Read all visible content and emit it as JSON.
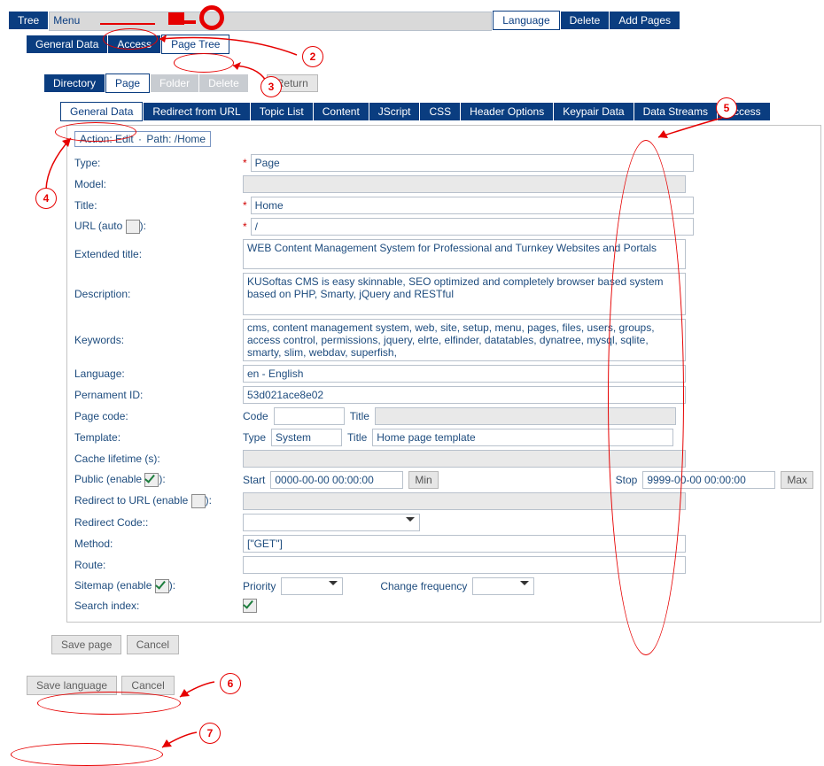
{
  "annotations": {
    "n2": "2",
    "n3": "3",
    "n4": "4",
    "n5": "5",
    "n6": "6",
    "n7": "7"
  },
  "menu1": {
    "tree": "Tree",
    "menu": "Menu",
    "language": "Language",
    "delete": "Delete",
    "addpages": "Add Pages"
  },
  "menu2": {
    "generaldata": "General Data",
    "access": "Access",
    "pagetree": "Page Tree"
  },
  "menu3": {
    "directory": "Directory",
    "page": "Page",
    "folder": "Folder",
    "delete": "Delete",
    "return": "Return"
  },
  "menu4": {
    "generaldata": "General Data",
    "redirect": "Redirect from URL",
    "topiclist": "Topic List",
    "content": "Content",
    "jscript": "JScript",
    "css": "CSS",
    "headeroptions": "Header Options",
    "keypairdata": "Keypair Data",
    "datastreams": "Data Streams",
    "access": "Access"
  },
  "legend": {
    "action": "Action: Edit",
    "dot": "·",
    "path": "Path: /Home"
  },
  "form": {
    "typeLabel": "Type:",
    "typeValue": "Page",
    "modelLabel": "Model:",
    "modelValue": "",
    "titleLabel": "Title:",
    "titleValue": "Home",
    "urlLabel_a": "URL (auto ",
    "urlLabel_b": "):",
    "urlValue": "/",
    "extTitleLabel": "Extended title:",
    "extTitleValue": "WEB Content Management System for Professional and Turnkey Websites and Portals",
    "descLabel": "Description:",
    "descValue": "KUSoftas CMS is easy skinnable, SEO optimized and completely browser based system based on PHP, Smarty, jQuery and RESTful",
    "keywordsLabel": "Keywords:",
    "keywordsValue": "cms, content management system, web, site, setup, menu, pages, files, users, groups, access control, permissions, jquery, elrte, elfinder, datatables, dynatree, mysql, sqlite, smarty, slim, webdav, superfish,",
    "langLabel": "Language:",
    "langValue": "en - English",
    "permIdLabel": "Pernament ID:",
    "permIdValue": "53d021ace8e02",
    "pageCodeLabel": "Page code:",
    "pcCode": "Code",
    "pcTitle": "Title",
    "templateLabel": "Template:",
    "tplTypeL": "Type",
    "tplType": "System",
    "tplTitleL": "Title",
    "tplTitle": "Home page template",
    "cacheLabel": "Cache lifetime (s):",
    "publicLabel_a": "Public (enable ",
    "publicLabel_b": "):",
    "startL": "Start",
    "startV": "0000-00-00 00:00:00",
    "minL": "Min",
    "stopL": "Stop",
    "stopV": "9999-00-00 00:00:00",
    "maxL": "Max",
    "redirUrlLabel_a": "Redirect to URL (enable ",
    "redirUrlLabel_b": "):",
    "redirCodeLabel": "Redirect Code::",
    "methodLabel": "Method:",
    "methodValue": "[\"GET\"]",
    "routeLabel": "Route:",
    "sitemapLabel_a": "Sitemap (enable ",
    "sitemapLabel_b": "):",
    "priorityL": "Priority",
    "changeFreqL": "Change frequency",
    "searchIndexLabel": "Search index:"
  },
  "save1": {
    "save": "Save page",
    "cancel": "Cancel"
  },
  "save2": {
    "save": "Save language",
    "cancel": "Cancel"
  }
}
